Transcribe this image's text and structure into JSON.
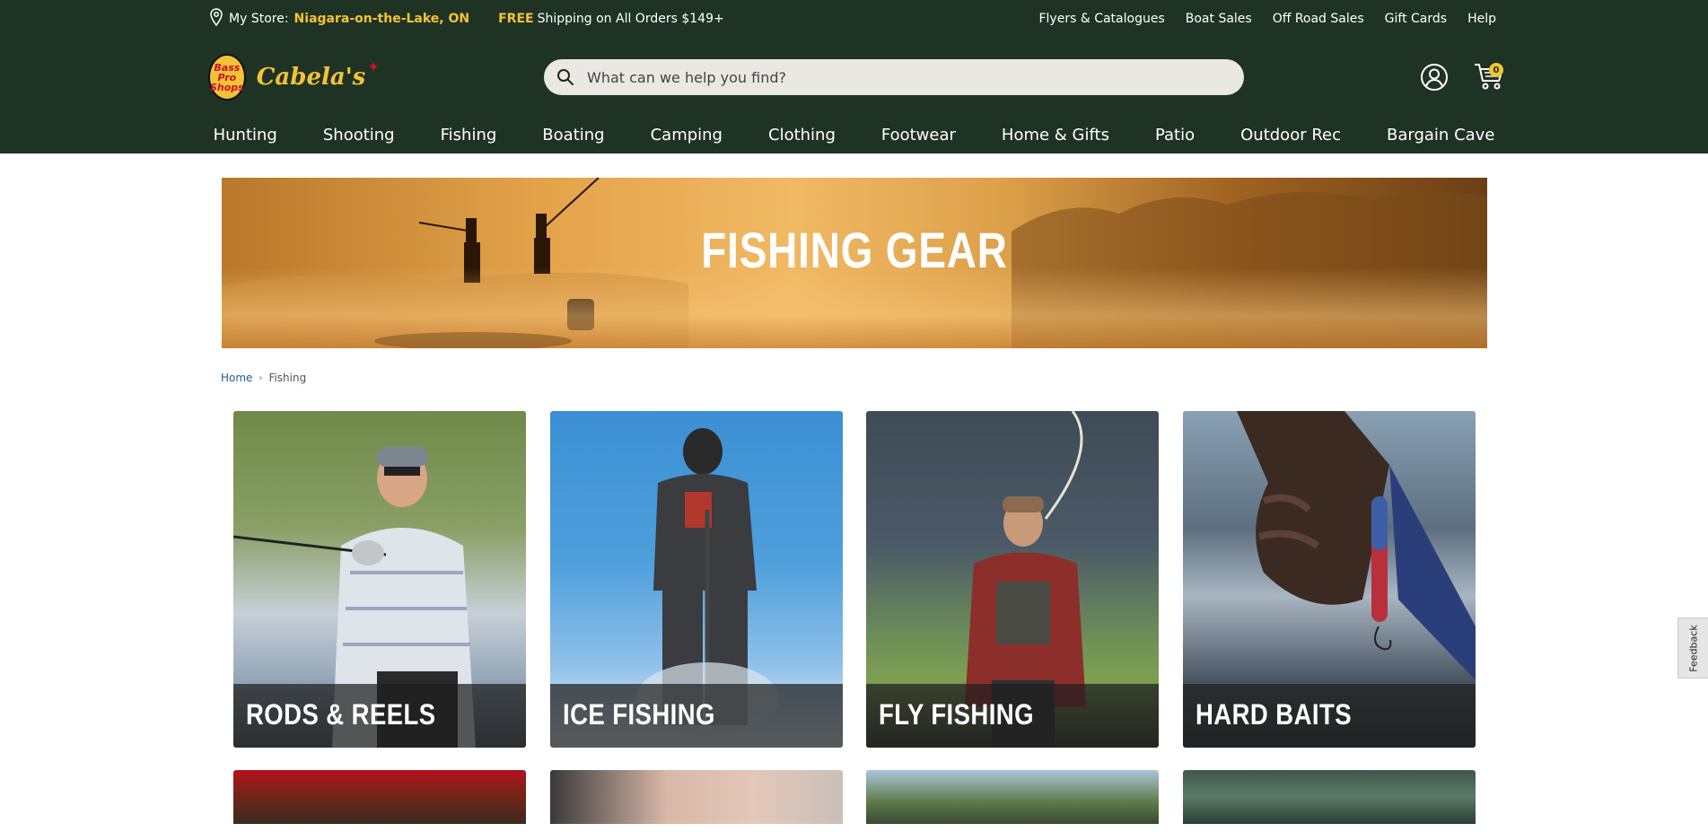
{
  "utility_bar": {
    "store_label": "My Store:",
    "store_name": "Niagara-on-the-Lake, ON",
    "promo_free": "FREE",
    "promo_text": "Shipping on All Orders $149+",
    "links": [
      "Flyers & Catalogues",
      "Boat Sales",
      "Off Road Sales",
      "Gift Cards",
      "Help"
    ]
  },
  "logo": {
    "primary": "Bass Pro Shops",
    "secondary": "Cabela's"
  },
  "search": {
    "placeholder": "What can we help you find?"
  },
  "cart": {
    "count": "0"
  },
  "nav": [
    "Hunting",
    "Shooting",
    "Fishing",
    "Boating",
    "Camping",
    "Clothing",
    "Footwear",
    "Home & Gifts",
    "Patio",
    "Outdoor Rec",
    "Bargain Cave"
  ],
  "hero": {
    "title": "FISHING GEAR"
  },
  "breadcrumb": {
    "home": "Home",
    "current": "Fishing"
  },
  "categories": [
    {
      "label": "RODS & REELS"
    },
    {
      "label": "ICE FISHING"
    },
    {
      "label": "FLY FISHING"
    },
    {
      "label": "HARD BAITS"
    }
  ],
  "feedback": {
    "label": "Feedback"
  },
  "colors": {
    "header_bg": "#1f3324",
    "accent_yellow": "#f3c336",
    "link_blue": "#1b5e96"
  }
}
